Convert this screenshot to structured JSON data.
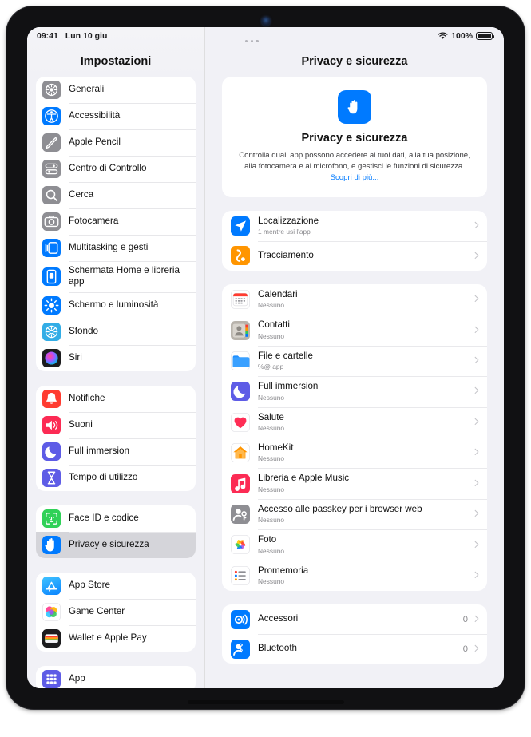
{
  "status_bar": {
    "time": "09:41",
    "date": "Lun 10 giu",
    "wifi_icon": "wifi-icon",
    "battery_percent": "100%",
    "battery_icon": "battery-full-icon"
  },
  "sidebar": {
    "title": "Impostazioni",
    "groups": [
      {
        "items": [
          {
            "label": "Generali",
            "icon": "gear-icon"
          },
          {
            "label": "Accessibilità",
            "icon": "accessibility-icon"
          },
          {
            "label": "Apple Pencil",
            "icon": "pencil-icon"
          },
          {
            "label": "Centro di Controllo",
            "icon": "control-center-icon"
          },
          {
            "label": "Cerca",
            "icon": "search-icon"
          },
          {
            "label": "Fotocamera",
            "icon": "camera-icon"
          },
          {
            "label": "Multitasking e gesti",
            "icon": "multitasking-icon"
          },
          {
            "label": "Schermata Home e libreria app",
            "icon": "home-screen-icon"
          },
          {
            "label": "Schermo e luminosità",
            "icon": "brightness-icon"
          },
          {
            "label": "Sfondo",
            "icon": "wallpaper-icon"
          },
          {
            "label": "Siri",
            "icon": "siri-icon"
          }
        ]
      },
      {
        "items": [
          {
            "label": "Notifiche",
            "icon": "bell-icon"
          },
          {
            "label": "Suoni",
            "icon": "speaker-icon"
          },
          {
            "label": "Full immersion",
            "icon": "moon-icon"
          },
          {
            "label": "Tempo di utilizzo",
            "icon": "hourglass-icon"
          }
        ]
      },
      {
        "items": [
          {
            "label": "Face ID e codice",
            "icon": "face-id-icon"
          },
          {
            "label": "Privacy e sicurezza",
            "icon": "hand-icon",
            "selected": true
          }
        ]
      },
      {
        "items": [
          {
            "label": "App Store",
            "icon": "app-store-icon"
          },
          {
            "label": "Game Center",
            "icon": "game-center-icon"
          },
          {
            "label": "Wallet e Apple Pay",
            "icon": "wallet-icon"
          }
        ]
      },
      {
        "items": [
          {
            "label": "App",
            "icon": "apps-grid-icon"
          }
        ]
      }
    ]
  },
  "content": {
    "title": "Privacy e sicurezza",
    "multitask_handle_icon": "multitask-dots-icon",
    "hero": {
      "icon": "hand-icon",
      "title": "Privacy e sicurezza",
      "description": "Controlla quali app possono accedere ai tuoi dati, alla tua posizione, alla fotocamera e al microfono, e gestisci le funzioni di sicurezza.",
      "link_label": "Scopri di più..."
    },
    "groups": [
      {
        "rows": [
          {
            "title": "Localizzazione",
            "subtitle": "1 mentre usi l'app",
            "icon": "location-arrow-icon"
          },
          {
            "title": "Tracciamento",
            "subtitle": "",
            "icon": "tracking-icon"
          }
        ]
      },
      {
        "rows": [
          {
            "title": "Calendari",
            "subtitle": "Nessuno",
            "icon": "calendar-icon"
          },
          {
            "title": "Contatti",
            "subtitle": "Nessuno",
            "icon": "contacts-icon"
          },
          {
            "title": "File e cartelle",
            "subtitle": "%@ app",
            "icon": "files-folder-icon"
          },
          {
            "title": "Full immersion",
            "subtitle": "Nessuno",
            "icon": "moon-icon"
          },
          {
            "title": "Salute",
            "subtitle": "Nessuno",
            "icon": "heart-icon"
          },
          {
            "title": "HomeKit",
            "subtitle": "Nessuno",
            "icon": "house-icon"
          },
          {
            "title": "Libreria e Apple Music",
            "subtitle": "Nessuno",
            "icon": "music-note-icon"
          },
          {
            "title": "Accesso alle passkey per i browser web",
            "subtitle": "Nessuno",
            "icon": "passkey-icon"
          },
          {
            "title": "Foto",
            "subtitle": "Nessuno",
            "icon": "photos-icon"
          },
          {
            "title": "Promemoria",
            "subtitle": "Nessuno",
            "icon": "reminders-icon"
          }
        ]
      },
      {
        "rows": [
          {
            "title": "Accessori",
            "subtitle": "",
            "value": "0",
            "icon": "accessories-icon"
          },
          {
            "title": "Bluetooth",
            "subtitle": "",
            "value": "0",
            "icon": "bluetooth-privacy-icon",
            "clipped": true
          }
        ]
      }
    ]
  }
}
